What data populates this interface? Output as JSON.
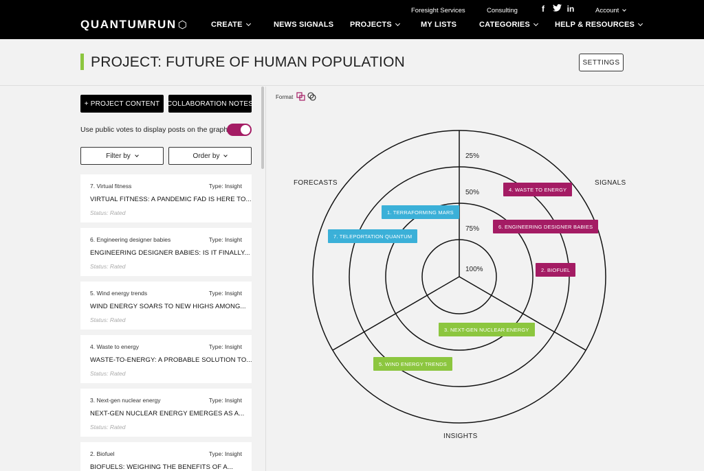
{
  "nav": {
    "logo": "QUANTUMRUN",
    "utility": {
      "foresight": "Foresight Services",
      "consulting": "Consulting",
      "account": "Account"
    },
    "social": {
      "facebook": "f",
      "twitter": "t",
      "linkedin": "in"
    },
    "items": [
      "CREATE",
      "NEWS SIGNALS",
      "PROJECTS",
      "MY LISTS",
      "CATEGORIES",
      "HELP & RESOURCES"
    ]
  },
  "project": {
    "title": "PROJECT: FUTURE OF HUMAN POPULATION",
    "settings_label": "SETTINGS"
  },
  "sidebar": {
    "add_content": "+ PROJECT CONTENT",
    "collab_notes": "COLLABORATION NOTES",
    "toggle_label": "Use public votes to display posts on the graph",
    "toggle_on": true,
    "filter_label": "Filter by",
    "order_label": "Order by",
    "cards": [
      {
        "meta": "7. Virtual fitness",
        "type": "Type: Insight",
        "title": "VIRTUAL FITNESS: A PANDEMIC FAD IS HERE TO...",
        "status": "Status: Rated"
      },
      {
        "meta": "6. Engineering designer babies",
        "type": "Type: Insight",
        "title": "ENGINEERING DESIGNER BABIES: IS IT FINALLY...",
        "status": "Status: Rated"
      },
      {
        "meta": "5. Wind energy trends",
        "type": "Type: Insight",
        "title": "WIND ENERGY SOARS TO NEW HIGHS AMONG...",
        "status": "Status: Rated"
      },
      {
        "meta": "4. Waste to energy",
        "type": "Type: Insight",
        "title": "WASTE-TO-ENERGY: A PROBABLE SOLUTION TO...",
        "status": "Status: Rated"
      },
      {
        "meta": "3. Next-gen nuclear energy",
        "type": "Type: Insight",
        "title": "NEXT-GEN NUCLEAR ENERGY EMERGES AS A...",
        "status": "Status: Rated"
      },
      {
        "meta": "2. Biofuel",
        "type": "Type: Insight",
        "title": "BIOFUELS: WEIGHING THE BENEFITS OF A...",
        "status": ""
      }
    ]
  },
  "graph": {
    "format_label": "Format",
    "quadrants": {
      "forecasts": "FORECASTS",
      "signals": "SIGNALS",
      "insights": "INSIGHTS"
    },
    "rings": [
      "25%",
      "50%",
      "75%",
      "100%"
    ],
    "colors": {
      "signals": "#a41c64",
      "forecasts": "#3bb0d8",
      "insights": "#8cc63f"
    },
    "tags": [
      {
        "label": "4. WASTE TO ENERGY",
        "category": "signals"
      },
      {
        "label": "1. TERRAFORMING MARS",
        "category": "forecasts"
      },
      {
        "label": "6. ENGINEERING DESIGNER BABIES",
        "category": "signals"
      },
      {
        "label": "7. TELEPORTATION QUANTUM",
        "category": "forecasts"
      },
      {
        "label": "2. BIOFUEL",
        "category": "signals"
      },
      {
        "label": "3. NEXT-GEN NUCLEAR ENERGY",
        "category": "insights"
      },
      {
        "label": "5. WIND ENERGY TRENDS",
        "category": "insights"
      }
    ]
  }
}
